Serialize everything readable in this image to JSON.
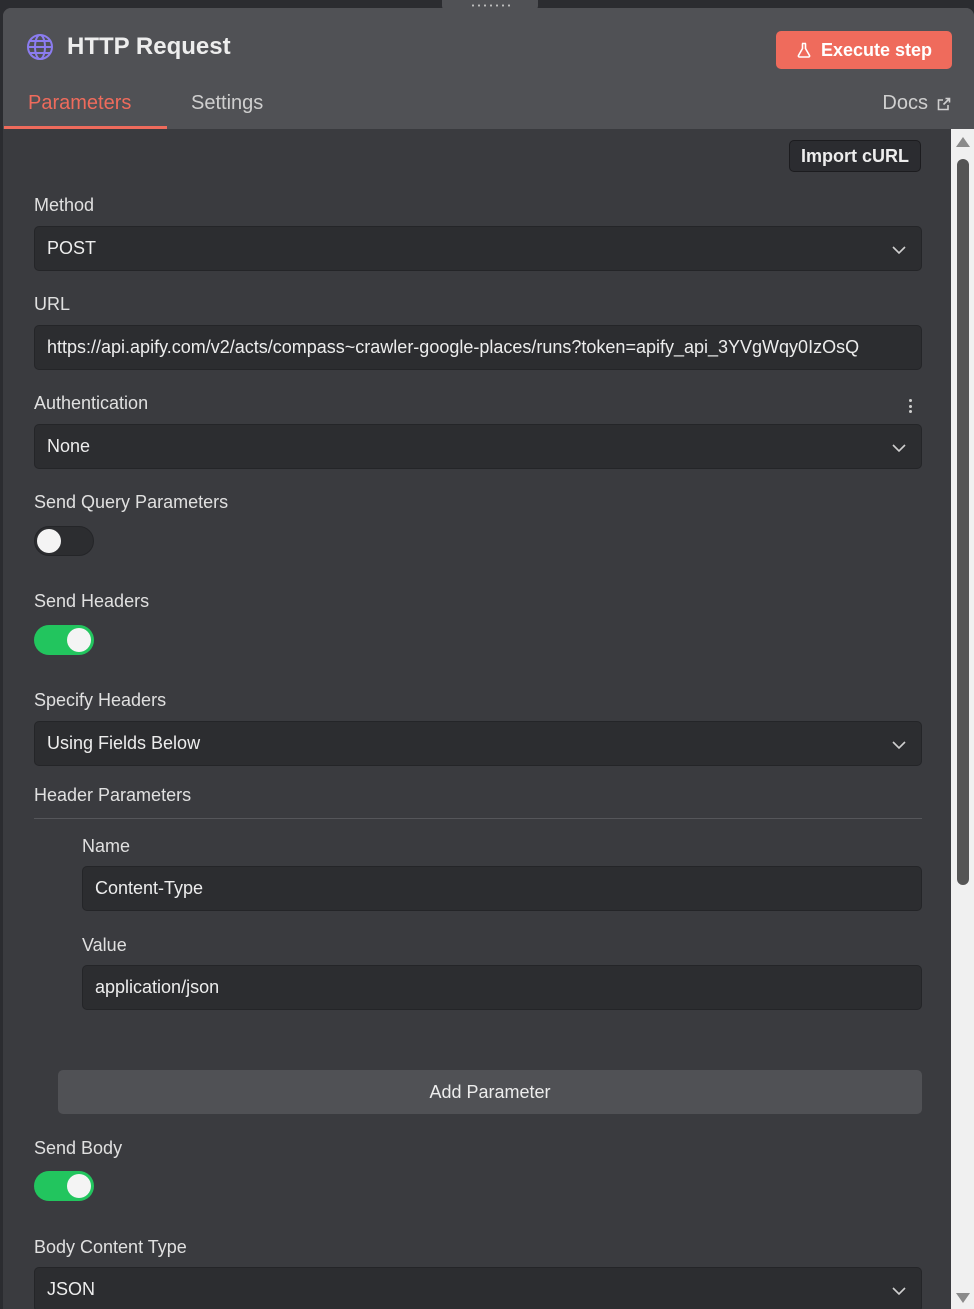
{
  "header": {
    "title": "HTTP Request",
    "title_icon": "globe-icon",
    "execute_label": "Execute step",
    "execute_icon": "flask-icon",
    "accent_color": "#ef6b5c"
  },
  "tabs": {
    "parameters": "Parameters",
    "settings": "Settings",
    "active": "Parameters",
    "docs": "Docs",
    "docs_icon": "external-link-icon"
  },
  "form": {
    "import_curl": "Import cURL",
    "method": {
      "label": "Method",
      "value": "POST"
    },
    "url": {
      "label": "URL",
      "value": "https://api.apify.com/v2/acts/compass~crawler-google-places/runs?token=apify_api_3YVgWqy0IzOsQ"
    },
    "authentication": {
      "label": "Authentication",
      "value": "None"
    },
    "send_query": {
      "label": "Send Query Parameters",
      "on": false
    },
    "send_headers": {
      "label": "Send Headers",
      "on": true
    },
    "specify_headers": {
      "label": "Specify Headers",
      "value": "Using Fields Below"
    },
    "header_parameters": {
      "label": "Header Parameters",
      "name_label": "Name",
      "name_value": "Content-Type",
      "value_label": "Value",
      "value_value": "application/json",
      "add_label": "Add Parameter"
    },
    "send_body": {
      "label": "Send Body",
      "on": true
    },
    "body_content_type": {
      "label": "Body Content Type",
      "value": "JSON"
    }
  }
}
